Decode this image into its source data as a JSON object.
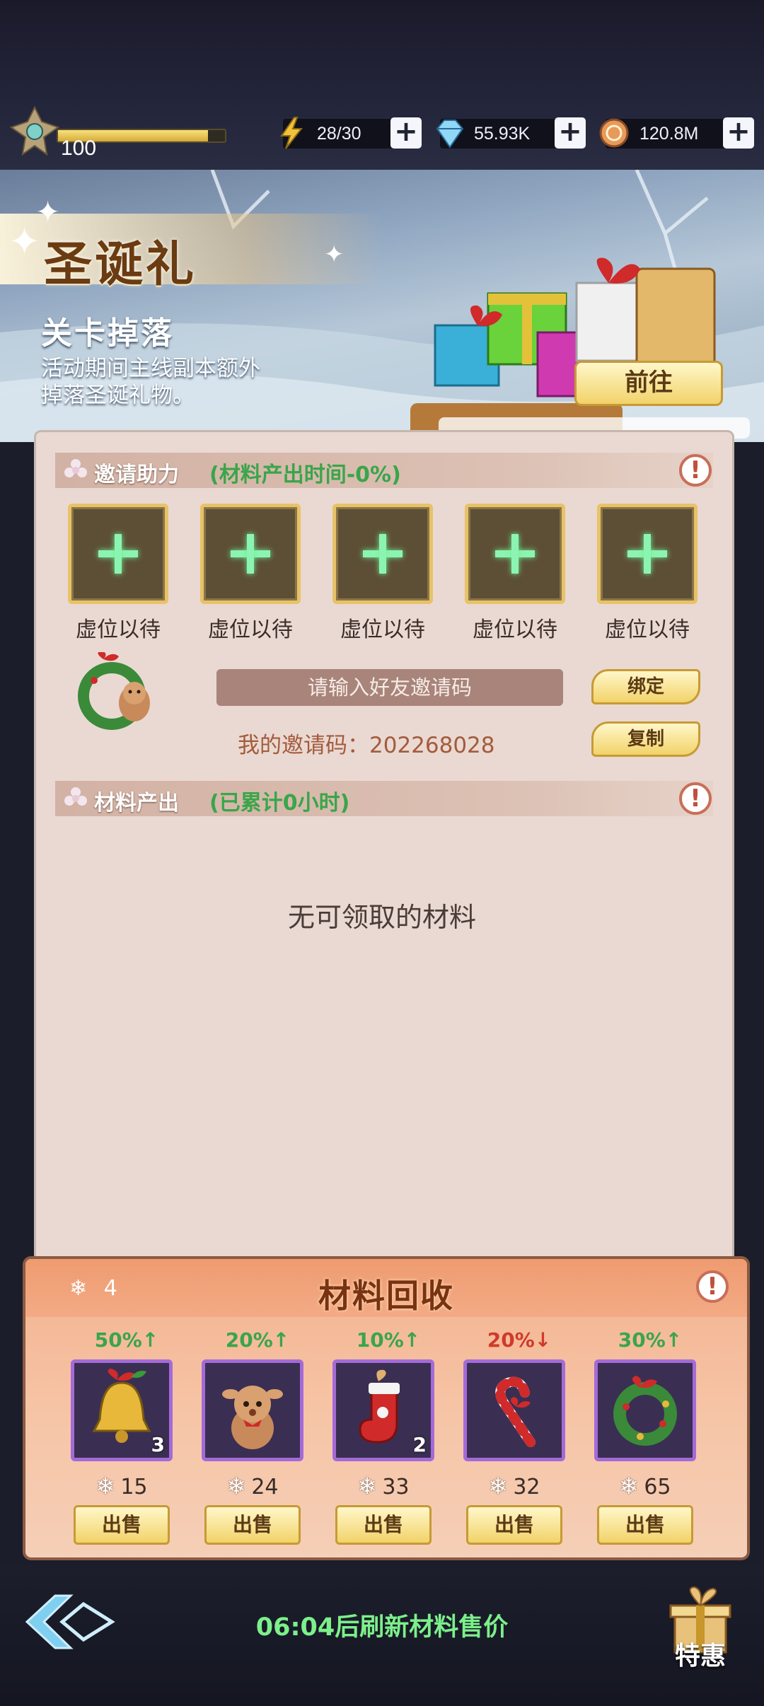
{
  "player": {
    "level": "100",
    "exp_fraction": 0.9
  },
  "resources": {
    "energy": "28/30",
    "crystal": "55.93K",
    "gold": "120.8M"
  },
  "banner": {
    "title": "圣诞礼",
    "drop_title": "关卡掉落",
    "drop_desc": "活动期间主线副本额外掉落圣诞礼物。",
    "goto_label": "前往"
  },
  "invite": {
    "header": "邀请助力",
    "note": "(材料产出时间-0%)",
    "slots": [
      "虚位以待",
      "虚位以待",
      "虚位以待",
      "虚位以待",
      "虚位以待"
    ],
    "input_placeholder": "请输入好友邀请码",
    "my_code": "我的邀请码：202268028",
    "bind_label": "绑定",
    "copy_label": "复制"
  },
  "output": {
    "header": "材料产出",
    "note": "(已累计0小时)",
    "empty": "无可领取的材料"
  },
  "recycle": {
    "title": "材料回收",
    "snow_count": "4",
    "items": [
      {
        "pct": "50%↑",
        "dir": "up",
        "icon": "bell-icon",
        "qty": "3",
        "price": "15",
        "sell": "出售"
      },
      {
        "pct": "20%↑",
        "dir": "up",
        "icon": "reindeer-plush-icon",
        "qty": "",
        "price": "24",
        "sell": "出售"
      },
      {
        "pct": "10%↑",
        "dir": "up",
        "icon": "stocking-icon",
        "qty": "2",
        "price": "33",
        "sell": "出售"
      },
      {
        "pct": "20%↓",
        "dir": "down",
        "icon": "candy-cane-icon",
        "qty": "",
        "price": "32",
        "sell": "出售"
      },
      {
        "pct": "30%↑",
        "dir": "up",
        "icon": "wreath-icon",
        "qty": "",
        "price": "65",
        "sell": "出售"
      }
    ]
  },
  "footer": {
    "refresh_text": "06:04后刷新材料售价",
    "special_label": "特惠"
  },
  "colors": {
    "accent_green": "#3aa54a",
    "down_red": "#d03a2b",
    "button_gold": "#f2d36a",
    "panel_bg": "#ead9d2"
  }
}
